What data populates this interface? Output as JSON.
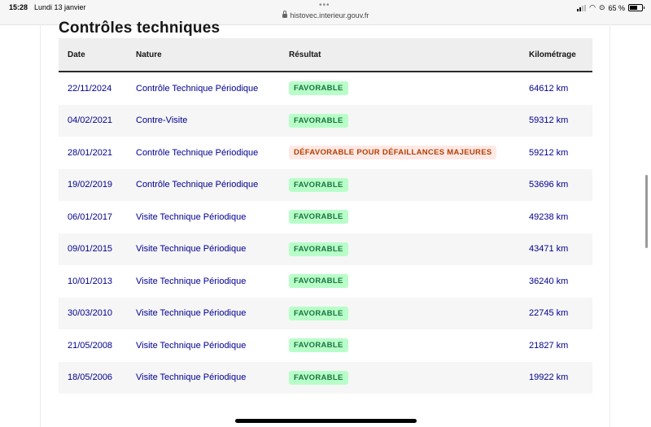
{
  "status_bar": {
    "time": "15:28",
    "date": "Lundi 13 janvier",
    "url": "histovec.interieur.gouv.fr",
    "battery": "65 %",
    "battery_level": 0.65
  },
  "section": {
    "title": "Contrôles techniques"
  },
  "table": {
    "headers": {
      "date": "Date",
      "nature": "Nature",
      "result": "Résultat",
      "mileage": "Kilométrage"
    },
    "rows": [
      {
        "date": "22/11/2024",
        "nature": "Contrôle Technique Périodique",
        "result": "FAVORABLE",
        "status": "ok",
        "mileage": "64612 km"
      },
      {
        "date": "04/02/2021",
        "nature": "Contre-Visite",
        "result": "FAVORABLE",
        "status": "ok",
        "mileage": "59312 km"
      },
      {
        "date": "28/01/2021",
        "nature": "Contrôle Technique Périodique",
        "result": "DÉFAVORABLE POUR DÉFAILLANCES MAJEURES",
        "status": "ko",
        "mileage": "59212 km"
      },
      {
        "date": "19/02/2019",
        "nature": "Contrôle Technique Périodique",
        "result": "FAVORABLE",
        "status": "ok",
        "mileage": "53696 km"
      },
      {
        "date": "06/01/2017",
        "nature": "Visite Technique Périodique",
        "result": "FAVORABLE",
        "status": "ok",
        "mileage": "49238 km"
      },
      {
        "date": "09/01/2015",
        "nature": "Visite Technique Périodique",
        "result": "FAVORABLE",
        "status": "ok",
        "mileage": "43471 km"
      },
      {
        "date": "10/01/2013",
        "nature": "Visite Technique Périodique",
        "result": "FAVORABLE",
        "status": "ok",
        "mileage": "36240 km"
      },
      {
        "date": "30/03/2010",
        "nature": "Visite Technique Périodique",
        "result": "FAVORABLE",
        "status": "ok",
        "mileage": "22745 km"
      },
      {
        "date": "21/05/2008",
        "nature": "Visite Technique Périodique",
        "result": "FAVORABLE",
        "status": "ok",
        "mileage": "21827 km"
      },
      {
        "date": "18/05/2006",
        "nature": "Visite Technique Périodique",
        "result": "FAVORABLE",
        "status": "ok",
        "mileage": "19922 km"
      }
    ]
  },
  "colors": {
    "link_blue": "#000091",
    "ok_bg": "#b8fec9",
    "ok_text": "#18753c",
    "ko_bg": "#ffe9e6",
    "ko_text": "#b34000",
    "header_bg": "#eeeeee"
  },
  "icons": [
    "more-dots-icon",
    "lock-icon",
    "signal-icon",
    "wifi-icon",
    "orientation-lock-icon",
    "battery-icon"
  ]
}
